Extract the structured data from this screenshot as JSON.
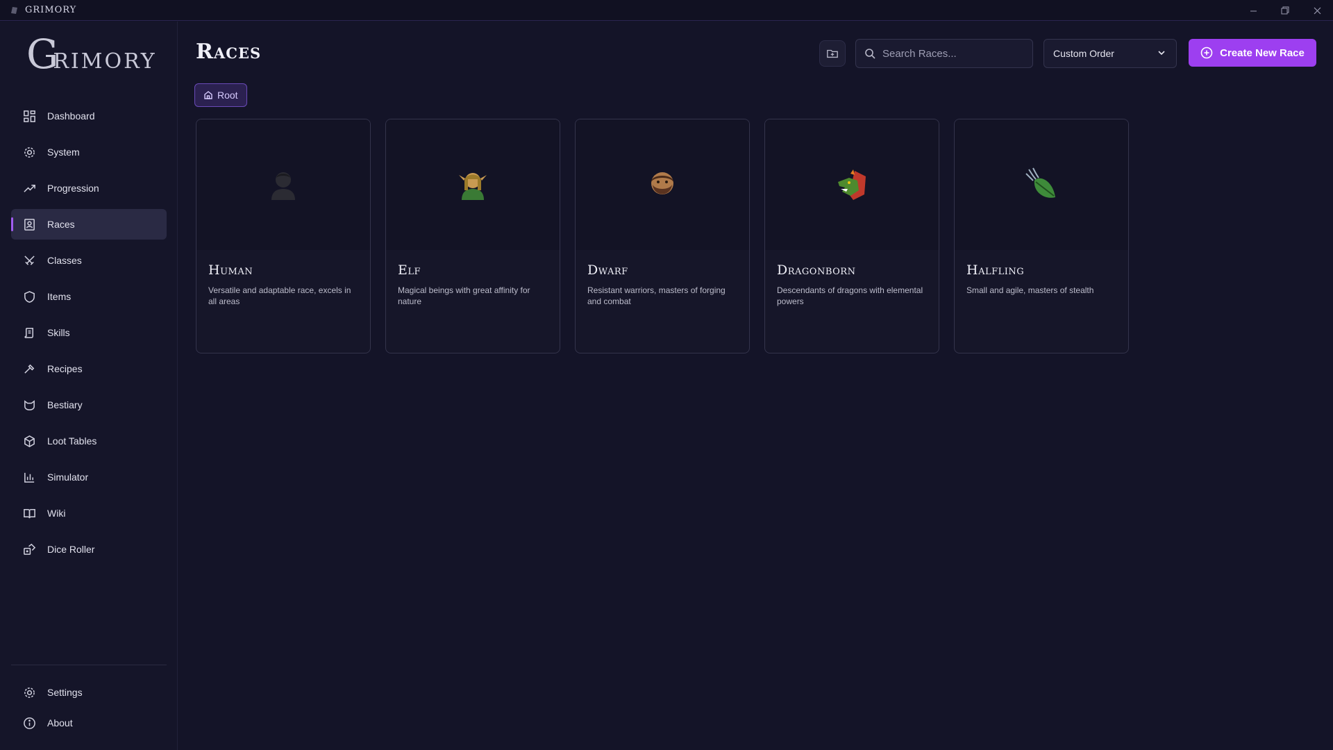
{
  "app": {
    "title": "GRIMORY",
    "logo_initial": "G",
    "logo_rest": "RIMORY"
  },
  "window_controls": [
    "minimize-icon",
    "restore-icon",
    "close-icon"
  ],
  "sidebar": {
    "items": [
      {
        "label": "Dashboard",
        "icon": "dashboard-icon"
      },
      {
        "label": "System",
        "icon": "gear-icon"
      },
      {
        "label": "Progression",
        "icon": "trending-up-icon"
      },
      {
        "label": "Races",
        "icon": "contact-book-icon",
        "active": true
      },
      {
        "label": "Classes",
        "icon": "crossed-swords-icon"
      },
      {
        "label": "Items",
        "icon": "shield-icon"
      },
      {
        "label": "Skills",
        "icon": "scroll-icon"
      },
      {
        "label": "Recipes",
        "icon": "hammer-icon"
      },
      {
        "label": "Bestiary",
        "icon": "cat-face-icon"
      },
      {
        "label": "Loot Tables",
        "icon": "package-icon"
      },
      {
        "label": "Simulator",
        "icon": "bar-chart-icon"
      },
      {
        "label": "Wiki",
        "icon": "open-book-icon"
      },
      {
        "label": "Dice Roller",
        "icon": "dice-icon"
      }
    ],
    "bottom_items": [
      {
        "label": "Settings",
        "icon": "settings-icon"
      },
      {
        "label": "About",
        "icon": "info-icon"
      }
    ]
  },
  "main": {
    "title": "Races",
    "search": {
      "placeholder": "Search Races..."
    },
    "sort": {
      "selected": "Custom Order"
    },
    "create_label": "Create New Race",
    "breadcrumb": {
      "label": "Root"
    },
    "cards": [
      {
        "name": "Human",
        "description": "Versatile and adaptable race, excels in all areas",
        "emoji": "person-dark-icon"
      },
      {
        "name": "Elf",
        "description": "Magical beings with great affinity for nature",
        "emoji": "elf-icon"
      },
      {
        "name": "Dwarf",
        "description": "Resistant warriors, masters of forging and combat",
        "emoji": "bearded-man-icon"
      },
      {
        "name": "Dragonborn",
        "description": "Descendants of dragons with elemental powers",
        "emoji": "dragon-face-icon"
      },
      {
        "name": "Halfling",
        "description": "Small and agile, masters of stealth",
        "emoji": "leaf-wind-icon"
      }
    ]
  },
  "colors": {
    "accent": "#9d3ff0",
    "background": "#141428",
    "sidebar": "#151529",
    "card": "#161629"
  }
}
